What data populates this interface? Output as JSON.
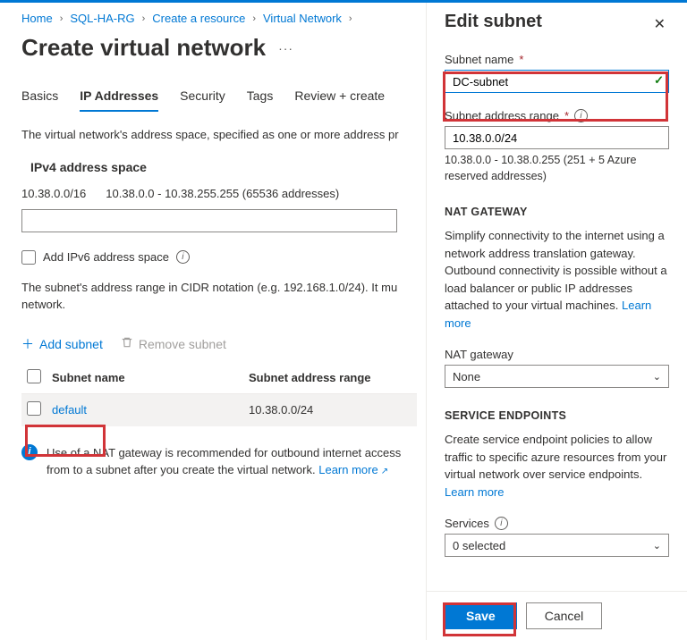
{
  "breadcrumb": {
    "items": [
      "Home",
      "SQL-HA-RG",
      "Create a resource",
      "Virtual Network"
    ],
    "current_short": ""
  },
  "page": {
    "title": "Create virtual network"
  },
  "tabs": {
    "items": [
      {
        "label": "Basics",
        "active": false
      },
      {
        "label": "IP Addresses",
        "active": true
      },
      {
        "label": "Security",
        "active": false
      },
      {
        "label": "Tags",
        "active": false
      },
      {
        "label": "Review + create",
        "active": false
      }
    ]
  },
  "main": {
    "address_space_text": "The virtual network's address space, specified as one or more address pr",
    "ipv4_header": "IPv4 address space",
    "cidr": "10.38.0.0/16",
    "cidr_range": "10.38.0.0 - 10.38.255.255 (65536 addresses)",
    "ipv6_checkbox_label": "Add IPv6 address space",
    "subnet_explain": "The subnet's address range in CIDR notation (e.g. 192.168.1.0/24). It mu",
    "subnet_explain2": "network.",
    "add_subnet": "Add subnet",
    "remove_subnet": "Remove subnet",
    "table": {
      "headers": {
        "name": "Subnet name",
        "range": "Subnet address range"
      },
      "rows": [
        {
          "name": "default",
          "range": "10.38.0.0/24"
        }
      ]
    },
    "nat_note_1": "Use of a NAT gateway is recommended for outbound internet access from",
    "nat_note_2": "to a subnet after you create the virtual network.",
    "learn_more": "Learn more"
  },
  "pane": {
    "title": "Edit subnet",
    "subnet_name_label": "Subnet name",
    "subnet_name_value": "DC-subnet",
    "addr_range_label": "Subnet address range",
    "addr_range_value": "10.38.0.0/24",
    "addr_range_hint": "10.38.0.0 - 10.38.0.255 (251 + 5 Azure reserved addresses)",
    "nat": {
      "caption": "NAT GATEWAY",
      "para": "Simplify connectivity to the internet using a network address translation gateway. Outbound connectivity is possible without a load balancer or public IP addresses attached to your virtual machines.",
      "learn_more": "Learn more",
      "label": "NAT gateway",
      "value": "None"
    },
    "se": {
      "caption": "SERVICE ENDPOINTS",
      "para": "Create service endpoint policies to allow traffic to specific azure resources from your virtual network over service endpoints.",
      "learn_more": "Learn more",
      "label": "Services",
      "value": "0 selected"
    },
    "save": "Save",
    "cancel": "Cancel"
  }
}
